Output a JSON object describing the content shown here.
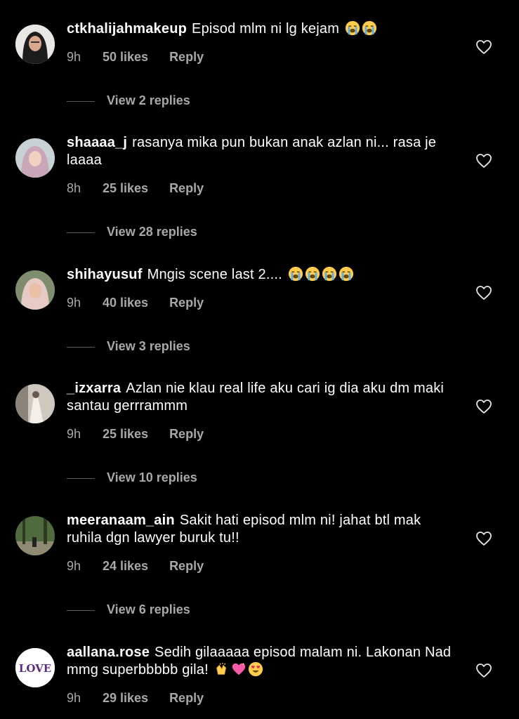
{
  "comments": [
    {
      "username": "ctkhalijahmakeup",
      "text": "Episod mlm ni lg kejam",
      "emojis": [
        "loudly-crying-face",
        "loudly-crying-face"
      ],
      "time": "9h",
      "likes": "50 likes",
      "reply": "Reply",
      "view_replies": "View 2 replies"
    },
    {
      "username": "shaaaa_j",
      "text": "rasanya mika pun bukan anak azlan ni... rasa je laaaa",
      "emojis": [],
      "time": "8h",
      "likes": "25 likes",
      "reply": "Reply",
      "view_replies": "View 28 replies"
    },
    {
      "username": "shihayusuf",
      "text": "Mngis scene last 2....",
      "emojis": [
        "loudly-crying-face",
        "loudly-crying-face",
        "loudly-crying-face",
        "loudly-crying-face"
      ],
      "time": "9h",
      "likes": "40 likes",
      "reply": "Reply",
      "view_replies": "View 3 replies"
    },
    {
      "username": "_izxarra",
      "text": "Azlan nie klau real life aku cari ig dia aku dm maki santau gerrrammm",
      "emojis": [],
      "time": "9h",
      "likes": "25 likes",
      "reply": "Reply",
      "view_replies": "View 10 replies"
    },
    {
      "username": "meeranaam_ain",
      "text": "Sakit hati episod mlm ni! jahat btl mak ruhila dgn lawyer buruk tu!!",
      "emojis": [],
      "time": "9h",
      "likes": "24 likes",
      "reply": "Reply",
      "view_replies": "View 6 replies"
    },
    {
      "username": "aallana.rose",
      "text": "Sedih gilaaaaa episod malam ni. Lakonan Nad mmg superbbbbb gila!",
      "emojis": [
        "clapping-hands",
        "sparkling-heart",
        "heart-eyes-face"
      ],
      "time": "9h",
      "likes": "29 likes",
      "reply": "Reply",
      "avatar_text": "LOVE"
    }
  ]
}
